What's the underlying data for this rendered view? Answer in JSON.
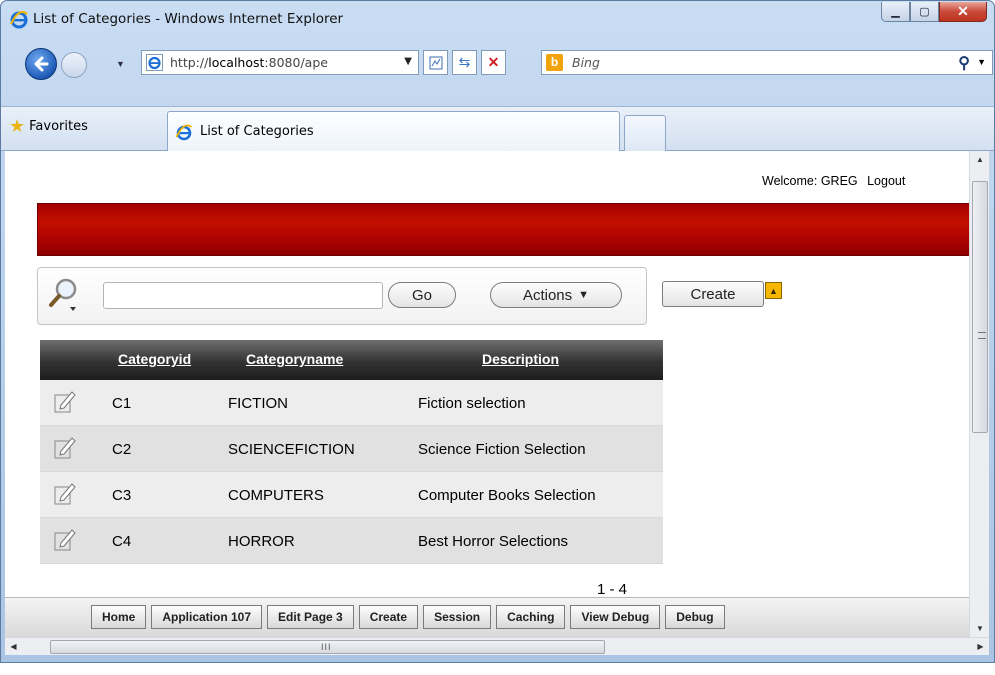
{
  "window": {
    "title": "List of Categories - Windows Internet Explorer"
  },
  "address_bar": {
    "url_prefix": "http://",
    "url_host": "localhost",
    "url_rest": ":8080/ape"
  },
  "search_bar": {
    "placeholder": "Bing"
  },
  "favorites": {
    "label": "Favorites"
  },
  "tabs": [
    {
      "label": "List of Categories",
      "active": true
    }
  ],
  "header": {
    "welcome": "Welcome: GREG",
    "logout": "Logout"
  },
  "toolbar": {
    "go_label": "Go",
    "actions_label": "Actions",
    "create_label": "Create"
  },
  "report": {
    "columns": [
      "Categoryid",
      "Categoryname",
      "Description"
    ],
    "rows": [
      {
        "id": "C1",
        "name": "FICTION",
        "description": "Fiction selection"
      },
      {
        "id": "C2",
        "name": "SCIENCEFICTION",
        "description": "Science Fiction Selection"
      },
      {
        "id": "C3",
        "name": "COMPUTERS",
        "description": "Computer Books Selection"
      },
      {
        "id": "C4",
        "name": "HORROR",
        "description": "Best Horror Selections"
      }
    ],
    "pagination": "1 - 4"
  },
  "developer_toolbar": [
    "Home",
    "Application 107",
    "Edit Page 3",
    "Create",
    "Session",
    "Caching",
    "View Debug",
    "Debug"
  ],
  "colors": {
    "banner": "#b00000",
    "report_header": "#2e2e2e",
    "titlebar": "#c8dcf2"
  }
}
